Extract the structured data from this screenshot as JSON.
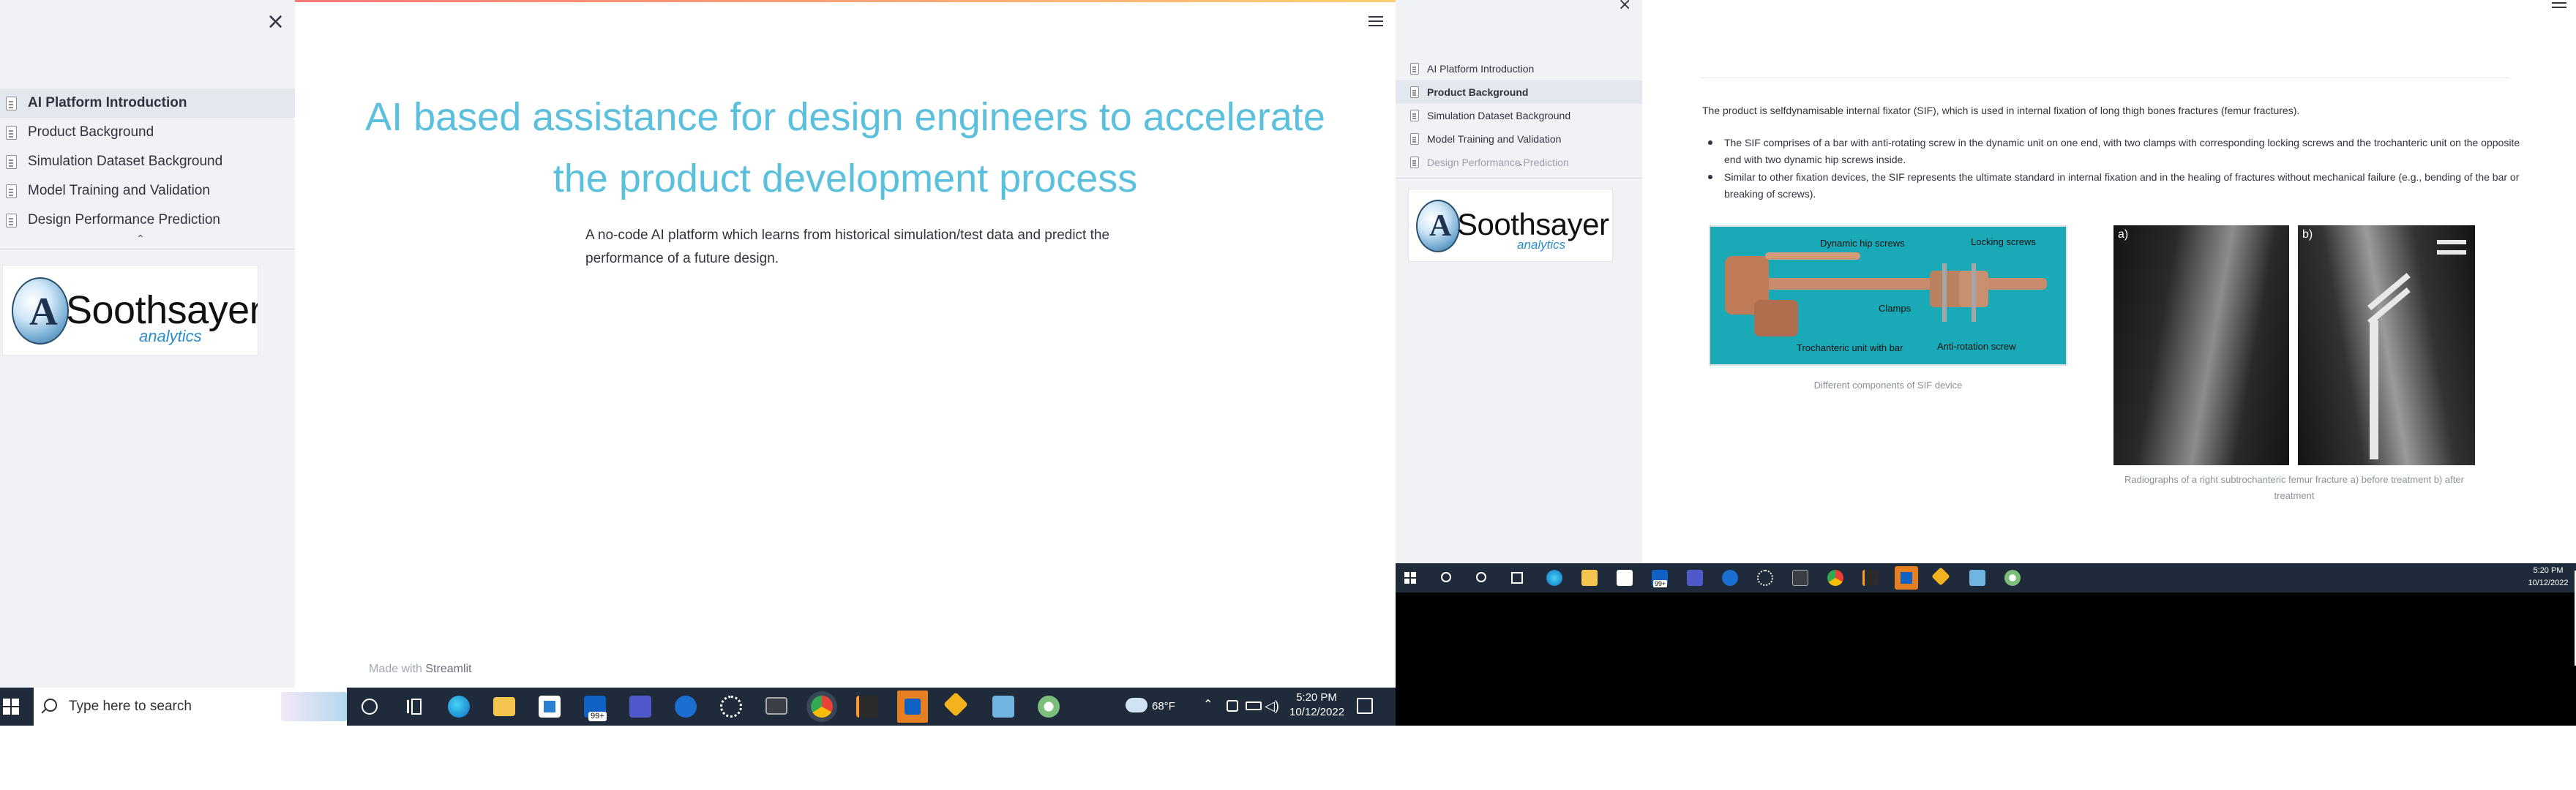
{
  "left_app": {
    "sidebar": {
      "items": [
        {
          "label": "AI Platform Introduction",
          "active": true
        },
        {
          "label": "Product Background",
          "active": false
        },
        {
          "label": "Simulation Dataset Background",
          "active": false
        },
        {
          "label": "Model Training and Validation",
          "active": false
        },
        {
          "label": "Design Performance Prediction",
          "active": false
        }
      ]
    },
    "logo": {
      "letter": "A",
      "name": "Soothsayer",
      "sub": "analytics"
    },
    "main": {
      "title": "AI based assistance for design engineers to accelerate the product development process",
      "description": "A no-code AI platform which learns from historical simulation/test data and predict the performance of a future design."
    },
    "footer": {
      "made_with": "Made with",
      "brand": "Streamlit"
    }
  },
  "left_taskbar": {
    "search_placeholder": "Type here to search",
    "badge": "99+",
    "weather": "68°F",
    "time": "5:20 PM",
    "date": "10/12/2022",
    "icons": [
      "start-icon",
      "cortana-icon",
      "task-view-icon",
      "edge-icon",
      "file-explorer-icon",
      "store-icon",
      "mail-icon",
      "teams-icon",
      "webex-icon",
      "settings-icon",
      "terminal-icon",
      "chrome-icon",
      "sublime-icon",
      "outlook-icon",
      "git-icon",
      "notepad-icon",
      "paint-icon",
      "weather-icon",
      "chevron-up-icon",
      "network-icon",
      "battery-icon",
      "volume-icon",
      "notification-icon"
    ]
  },
  "right_app": {
    "sidebar": {
      "items": [
        {
          "label": "AI Platform Introduction",
          "active": false
        },
        {
          "label": "Product Background",
          "active": true
        },
        {
          "label": "Simulation Dataset Background",
          "active": false
        },
        {
          "label": "Model Training and Validation",
          "active": false
        },
        {
          "label": "Design Performance Prediction",
          "active": false
        }
      ]
    },
    "logo": {
      "letter": "A",
      "name": "Soothsayer",
      "sub": "analytics"
    },
    "intro": "The product is selfdynamisable internal fixator (SIF), which is used in internal fixation of long thigh bones fractures (femur fractures).",
    "bullets": [
      "The SIF comprises of a bar with anti-rotating screw in the dynamic unit on one end, with two clamps with corresponding locking screws and the trochanteric unit on the opposite end with two dynamic hip screws inside.",
      "Similar to other fixation devices, the SIF represents the ultimate standard in internal fixation and in the healing of fractures without mechanical failure (e.g., bending of the bar or breaking of screws)."
    ],
    "sif_image": {
      "labels": [
        "Dynamic hip screws",
        "Locking screws",
        "Clamps",
        "Trochanteric unit with bar",
        "Anti-rotation screw"
      ],
      "caption": "Different components of SIF device"
    },
    "xray_image": {
      "labels": [
        "a)",
        "b)"
      ],
      "caption": "Radiographs of a right subtrochanteric femur fracture a) before treatment b) after treatment"
    }
  },
  "right_taskbar": {
    "badge": "99+",
    "time": "5:20 PM",
    "date": "10/12/2022"
  },
  "colors": {
    "title_accent": "#5bc0de",
    "sidebar_bg": "#f0f2f6",
    "taskbar_bg": "#1f2b3a",
    "streamlit_red": "#ff4b4b"
  }
}
